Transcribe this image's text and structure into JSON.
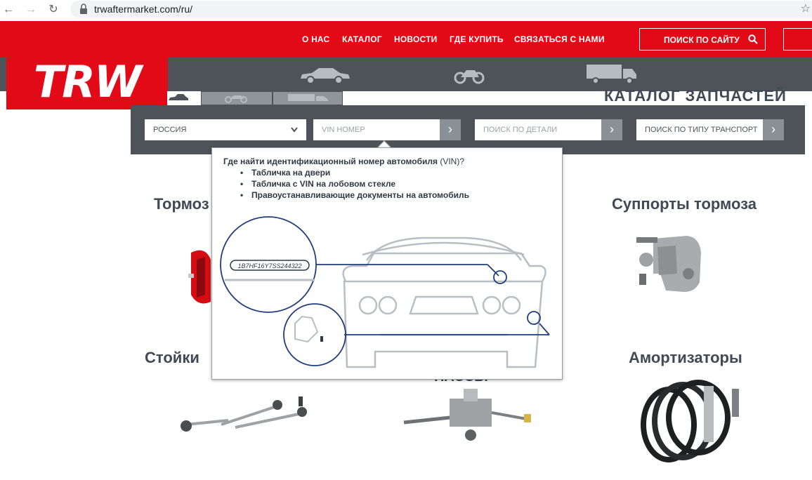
{
  "browser": {
    "url": "trwaftermarket.com/ru/"
  },
  "nav": {
    "items": [
      "О НАС",
      "КАТАЛОГ",
      "НОВОСТИ",
      "ГДЕ КУПИТЬ",
      "СВЯЗАТЬСЯ С НАМИ"
    ],
    "search_label": "ПОИСК ПО САЙТУ"
  },
  "logo": {
    "text": "TRW"
  },
  "catalog": {
    "title": "КАТАЛОГ ЗАПЧАСТЕЙ",
    "country": "РОССИЯ",
    "vin_placeholder": "VIN НОМЕР",
    "part_placeholder": "ПОИСК ПО ДЕТАЛИ",
    "vehicle_type": "ПОИСК ПО ТИПУ ТРАНСПОРТ"
  },
  "popup": {
    "title_bold": "Где найти идентификационный номер автомобиля",
    "title_normal": " (VIN)?",
    "items": [
      "Табличка на двери",
      "Табличка с VIN на лобовом стекле",
      "Правоустанавливающие документы на автомобиль"
    ],
    "vin_sample": "1B7HF16Y7SS244322"
  },
  "products": {
    "brakes": "Тормоз",
    "calipers": "Суппорты тормоза",
    "struts": "Стойки",
    "columns_partial": "ПАССЫ",
    "shocks": "Амортизаторы"
  },
  "colors": {
    "brand_red": "#e30a17",
    "band_grey": "#4d5359"
  }
}
